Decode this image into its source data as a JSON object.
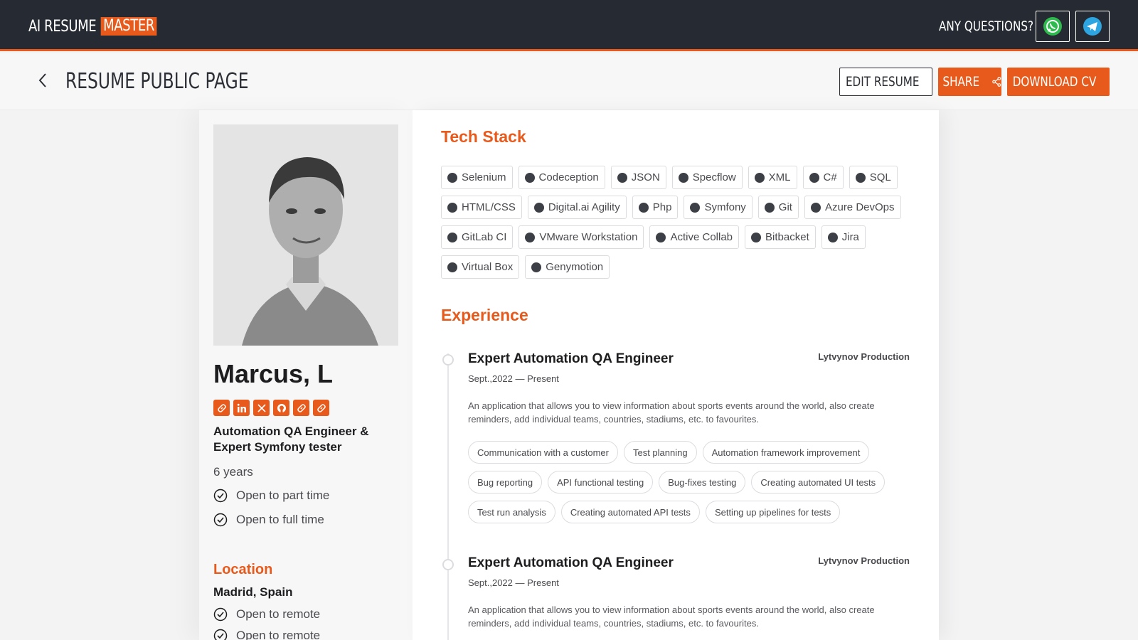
{
  "topbar": {
    "logo_main": "AI RESUME",
    "logo_accent": "MASTER",
    "questions": "ANY QUESTIONS?"
  },
  "header": {
    "title": "RESUME PUBLIC PAGE",
    "edit_label": "EDIT RESUME",
    "share_label": "SHARE",
    "download_label": "DOWNLOAD CV"
  },
  "profile": {
    "name": "Marcus, L",
    "role": "Automation QA Engineer & Expert Symfony tester",
    "years": "6 years",
    "availability": [
      "Open to part time",
      "Open to full time"
    ],
    "location_title": "Location",
    "city": "Madrid, Spain",
    "remote": [
      "Open to remote",
      "Open to remote"
    ]
  },
  "tech": {
    "title": "Tech Stack",
    "items": [
      "Selenium",
      "Codeception",
      "JSON",
      "Specflow",
      "XML",
      "C#",
      "SQL",
      "HTML/CSS",
      "Digital.ai Agility",
      "Php",
      "Symfony",
      "Git",
      "Azure DevOps",
      "GitLab CI",
      "VMware Workstation",
      "Active Collab",
      "Bitbacket",
      "Jira",
      "Virtual Box",
      "Genymotion"
    ]
  },
  "experience": {
    "title": "Experience",
    "jobs": [
      {
        "title": "Expert Automation QA Engineer",
        "company": "Lytvynov Production",
        "dates": "Sept.,2022 — Present",
        "description": "An application that allows you to view information about sports events around the world, also create reminders, add individual teams, countries, stadiums, etc. to favourites.",
        "tags": [
          "Communication with a customer",
          "Test planning",
          "Automation framework improvement",
          "Bug reporting",
          "API functional testing",
          "Bug-fixes testing",
          "Creating automated UI tests",
          "Test run analysis",
          "Creating automated API tests",
          "Setting up pipelines for tests"
        ]
      },
      {
        "title": "Expert Automation QA Engineer",
        "company": "Lytvynov Production",
        "dates": "Sept.,2022 — Present",
        "description": "An application that allows you to view information about sports events around the world, also create reminders, add individual teams, countries, stadiums, etc. to favourites."
      }
    ]
  },
  "colors": {
    "accent": "#e85a1b",
    "dark": "#262a33"
  }
}
